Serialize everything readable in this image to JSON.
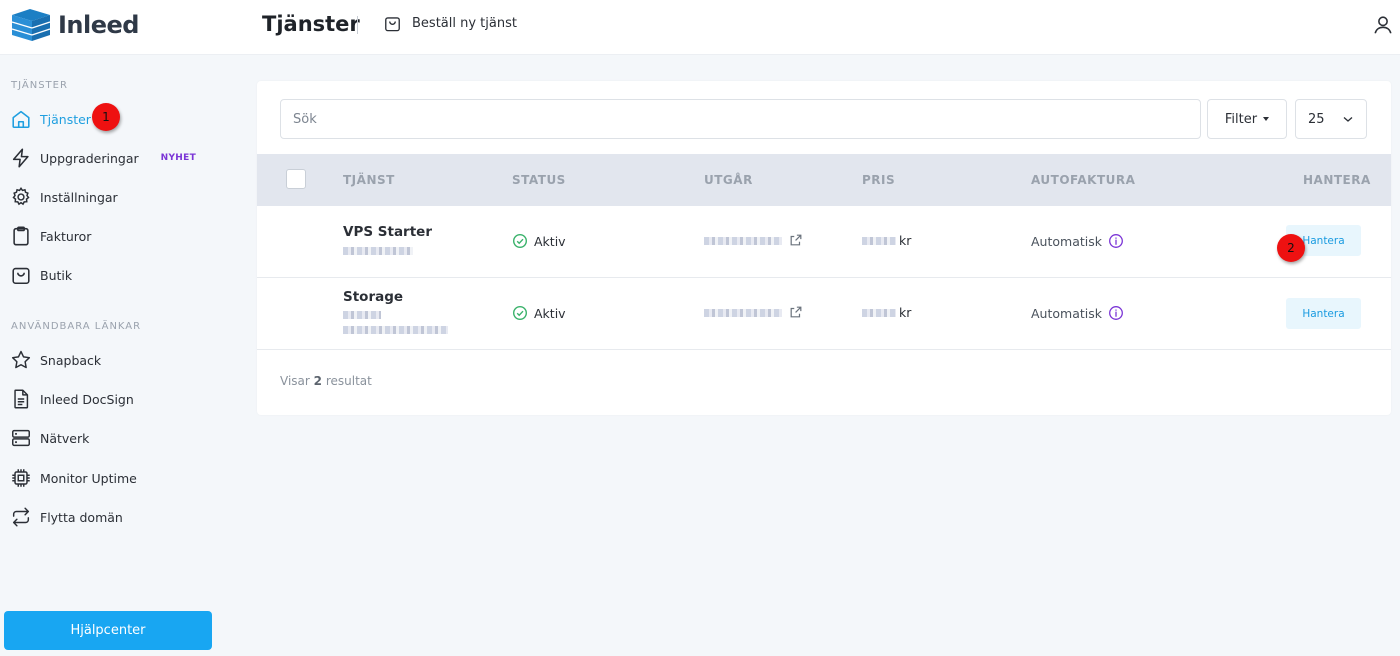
{
  "app": {
    "name": "Inleed"
  },
  "header": {
    "title": "Tjänster",
    "order_link": "Beställ ny tjänst"
  },
  "sidebar": {
    "section_services": "TJÄNSTER",
    "items": [
      {
        "label": "Tjänster",
        "icon": "home-icon",
        "active": true
      },
      {
        "label": "Uppgraderingar",
        "icon": "lightning-icon",
        "badge": "NYHET"
      },
      {
        "label": "Inställningar",
        "icon": "gear-icon"
      },
      {
        "label": "Fakturor",
        "icon": "clipboard-icon"
      },
      {
        "label": "Butik",
        "icon": "shopping-bag-icon"
      }
    ],
    "section_links": "ANVÄNDBARA LÄNKAR",
    "links": [
      {
        "label": "Snapback",
        "icon": "star-icon"
      },
      {
        "label": "Inleed DocSign",
        "icon": "document-icon"
      },
      {
        "label": "Nätverk",
        "icon": "server-icon"
      },
      {
        "label": "Monitor Uptime",
        "icon": "chip-icon"
      },
      {
        "label": "Flytta domän",
        "icon": "transfer-icon"
      }
    ],
    "help_button": "Hjälpcenter"
  },
  "markers": {
    "first": "1",
    "second": "2"
  },
  "toolbar": {
    "search_placeholder": "Sök",
    "filter_label": "Filter",
    "per_page": "25"
  },
  "table": {
    "columns": [
      "TJÄNST",
      "STATUS",
      "UTGÅR",
      "PRIS",
      "AUTOFAKTURA",
      "HANTERA"
    ],
    "rows": [
      {
        "name": "VPS Starter",
        "status": "Aktiv",
        "price_suffix": "kr",
        "autoinvoice": "Automatisk",
        "action": "Hantera"
      },
      {
        "name": "Storage",
        "status": "Aktiv",
        "price_suffix": "kr",
        "autoinvoice": "Automatisk",
        "action": "Hantera"
      }
    ]
  },
  "footer": {
    "prefix": "Visar",
    "count": "2",
    "suffix": "resultat"
  },
  "colors": {
    "accent": "#18a6f2",
    "active_nav": "#1f9fe0",
    "status_green": "#3ab26b",
    "badge_purple": "#7b35d6"
  }
}
